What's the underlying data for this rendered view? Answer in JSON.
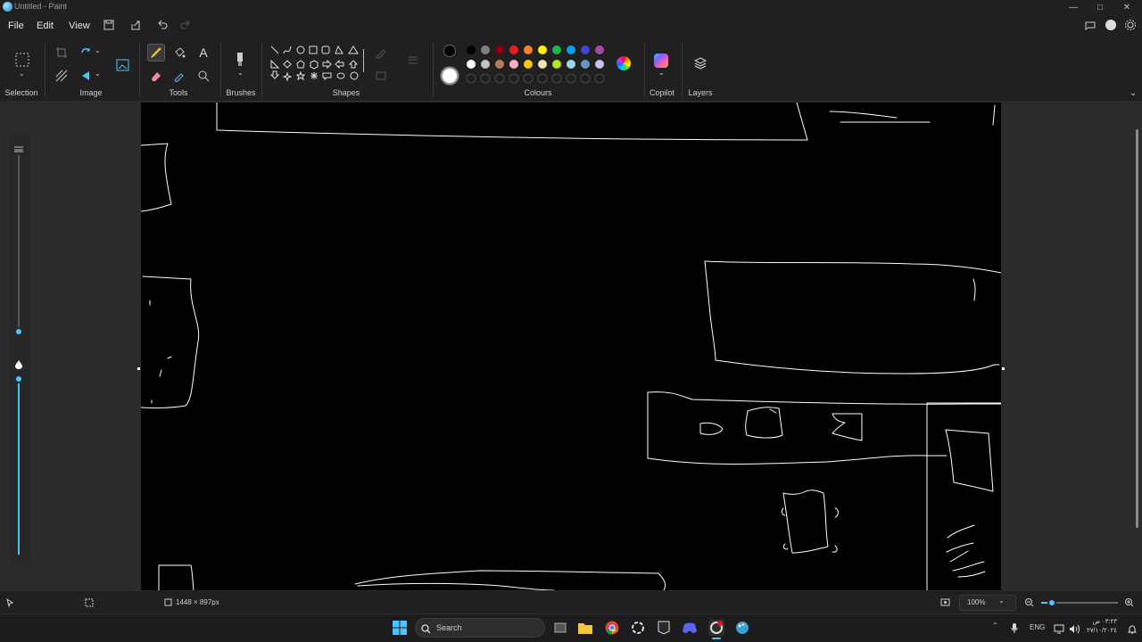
{
  "window": {
    "title": "Untitled - Paint"
  },
  "menu": {
    "file": "File",
    "edit": "Edit",
    "view": "View"
  },
  "groups": {
    "selection": "Selection",
    "image": "Image",
    "tools": "Tools",
    "brushes": "Brushes",
    "shapes": "Shapes",
    "colours": "Colours",
    "copilot": "Copilot",
    "layers": "Layers"
  },
  "colors": {
    "row1": [
      "#000000",
      "#7f7f7f",
      "#880015",
      "#ed1c24",
      "#ff7f27",
      "#fff200",
      "#22b14c",
      "#00a2e8",
      "#3f48cc",
      "#a349a4"
    ],
    "row2": [
      "#ffffff",
      "#c3c3c3",
      "#b97a57",
      "#ffaec9",
      "#ffc90e",
      "#efe4b0",
      "#b5e61d",
      "#99d9ea",
      "#7092be",
      "#c8bfe7"
    ],
    "primary": "#000000",
    "secondary": "#ffffff",
    "accent": "#4cc2ff"
  },
  "status": {
    "canvas_size": "1448 × 897px",
    "zoom": "100%"
  },
  "taskbar": {
    "search_placeholder": "Search",
    "lang": "ENG",
    "time": "٠٣:٢٣ ص",
    "date": "٢٧/١٠/٢٠٢٤"
  }
}
